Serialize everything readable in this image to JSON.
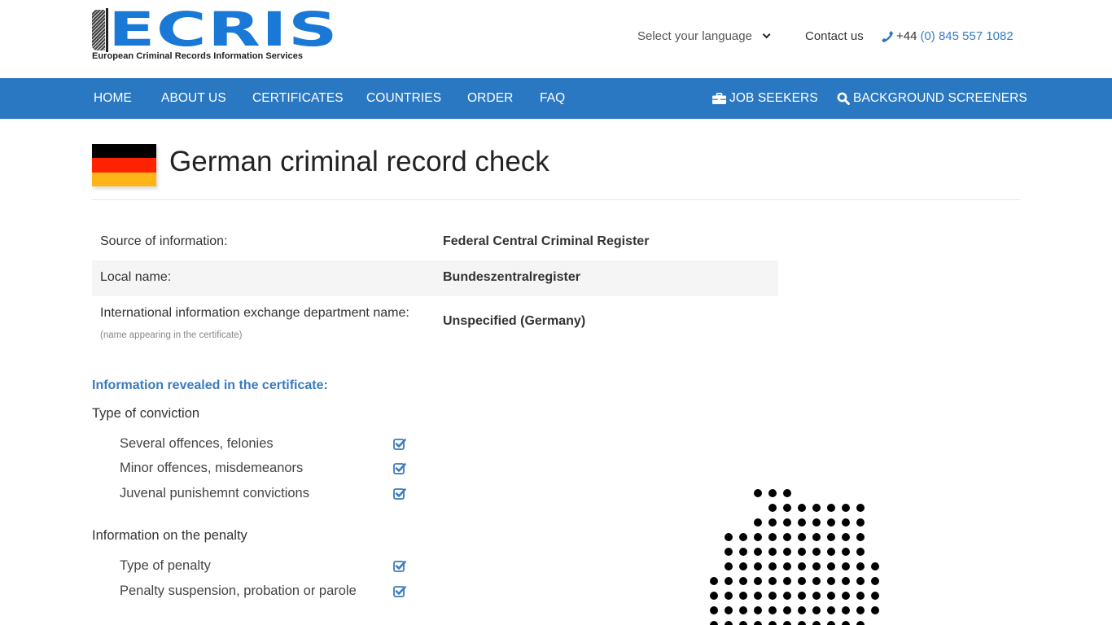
{
  "header": {
    "logo_text": "ECRIS",
    "logo_tagline": "European Criminal Records Information Services",
    "language_select": "Select your language",
    "contact_link": "Contact us",
    "phone_prefix": "+44",
    "phone_number": "(0) 845 557 1082"
  },
  "nav": {
    "items": [
      {
        "label": "HOME"
      },
      {
        "label": "ABOUT US"
      },
      {
        "label": "CERTIFICATES"
      },
      {
        "label": "COUNTRIES"
      },
      {
        "label": "ORDER"
      },
      {
        "label": "FAQ"
      }
    ],
    "job_seekers": "JOB SEEKERS",
    "background_screeners": "BACKGROUND SCREENERS"
  },
  "page": {
    "title": "German criminal record check",
    "flag_colors": [
      "#000000",
      "#ff2200",
      "#ffb515"
    ]
  },
  "info": [
    {
      "label": "Source of information:",
      "value": "Federal Central Criminal Register"
    },
    {
      "label": "Local name:",
      "value": "Bundeszentralregister"
    },
    {
      "label": "International information exchange department name:",
      "sublabel": "(name appearing in the certificate)",
      "value": "Unspecified (Germany)"
    }
  ],
  "revealed": {
    "heading": "Information revealed in the certificate:",
    "groups": [
      {
        "title": "Type of conviction",
        "items": [
          {
            "label": "Several offences, felonies",
            "checked": true
          },
          {
            "label": "Minor offences, misdemeanors",
            "checked": true
          },
          {
            "label": "Juvenal punishemnt convictions",
            "checked": true
          }
        ]
      },
      {
        "title": "Information on the penalty",
        "items": [
          {
            "label": "Type of penalty",
            "checked": true
          },
          {
            "label": "Penalty suspension, probation or parole",
            "checked": true
          }
        ]
      }
    ]
  },
  "colors": {
    "brand_blue": "#2b78c2",
    "link_blue": "#3a7bbf"
  }
}
